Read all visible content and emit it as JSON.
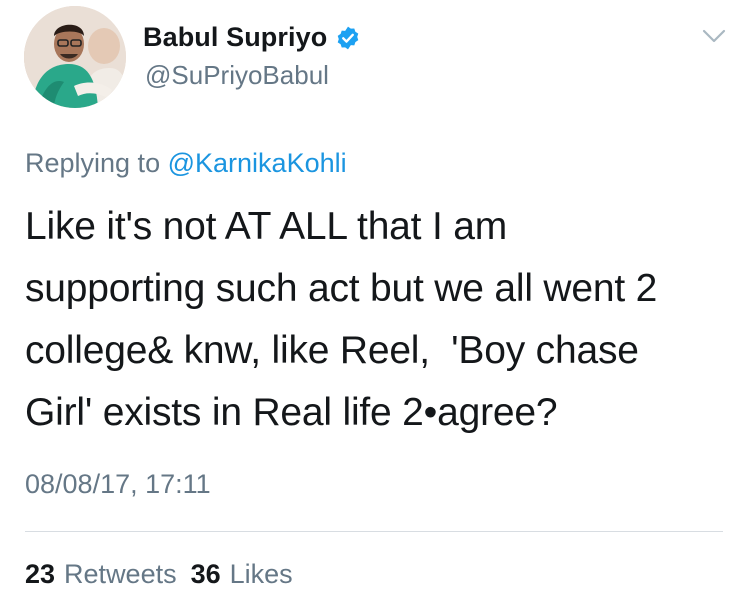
{
  "author": {
    "display_name": "Babul Supriyo",
    "handle": "@SuPriyoBabul",
    "verified": true,
    "avatar": "avatar-photo"
  },
  "reply": {
    "prefix": "Replying to",
    "mention": "@KarnikaKohli"
  },
  "tweet": {
    "lines": [
      "Like it's not AT ALL that I am",
      "supporting such act but we all went 2",
      "college& knw, like Reel,  'Boy chase",
      "Girl' exists in Real life 2•agree?"
    ],
    "timestamp": "08/08/17, 17:11"
  },
  "stats": {
    "retweets_count": "23",
    "retweets_label": "Retweets",
    "likes_count": "36",
    "likes_label": "Likes"
  },
  "icons": {
    "verified": "verified-badge-icon",
    "menu": "chevron-down-icon"
  },
  "colors": {
    "text": "#14171a",
    "secondary": "#657786",
    "link": "#1b95e0",
    "verified": "#1da1f2",
    "divider": "#d8dde2"
  }
}
